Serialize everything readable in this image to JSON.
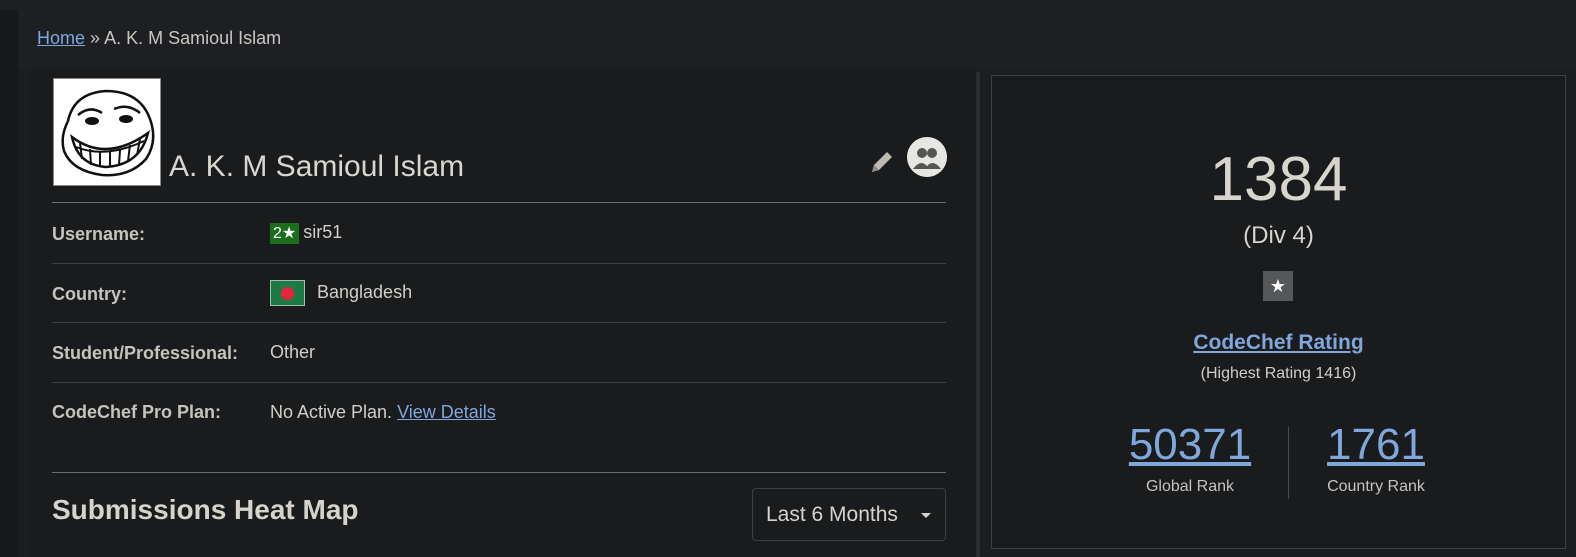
{
  "breadcrumb": {
    "home": "Home",
    "separator": "»",
    "current": "A. K. M Samioul Islam"
  },
  "profile": {
    "name": "A. K. M Samioul Islam",
    "avatar": "troll-face-avatar",
    "edit_icon": "pencil-icon",
    "follow_icon": "users-icon"
  },
  "details": {
    "username_label": "Username:",
    "username_stars": "2★",
    "username": "sir51",
    "country_label": "Country:",
    "country_flag": "bangladesh-flag",
    "country": "Bangladesh",
    "status_label": "Student/Professional:",
    "status": "Other",
    "pro_label": "CodeChef Pro Plan:",
    "pro_value": "No Active Plan.",
    "pro_link": "View Details"
  },
  "heatmap": {
    "title": "Submissions Heat Map",
    "range_selected": "Last 6 Months"
  },
  "rating": {
    "value": "1384",
    "division": "(Div 4)",
    "star": "★",
    "label": "CodeChef Rating",
    "highest": "(Highest Rating 1416)",
    "global_rank": "50371",
    "global_rank_label": "Global Rank",
    "country_rank": "1761",
    "country_rank_label": "Country Rank"
  },
  "colors": {
    "background": "#17181a",
    "link": "#7fa7db",
    "star_badge": "#1b6e1b"
  }
}
